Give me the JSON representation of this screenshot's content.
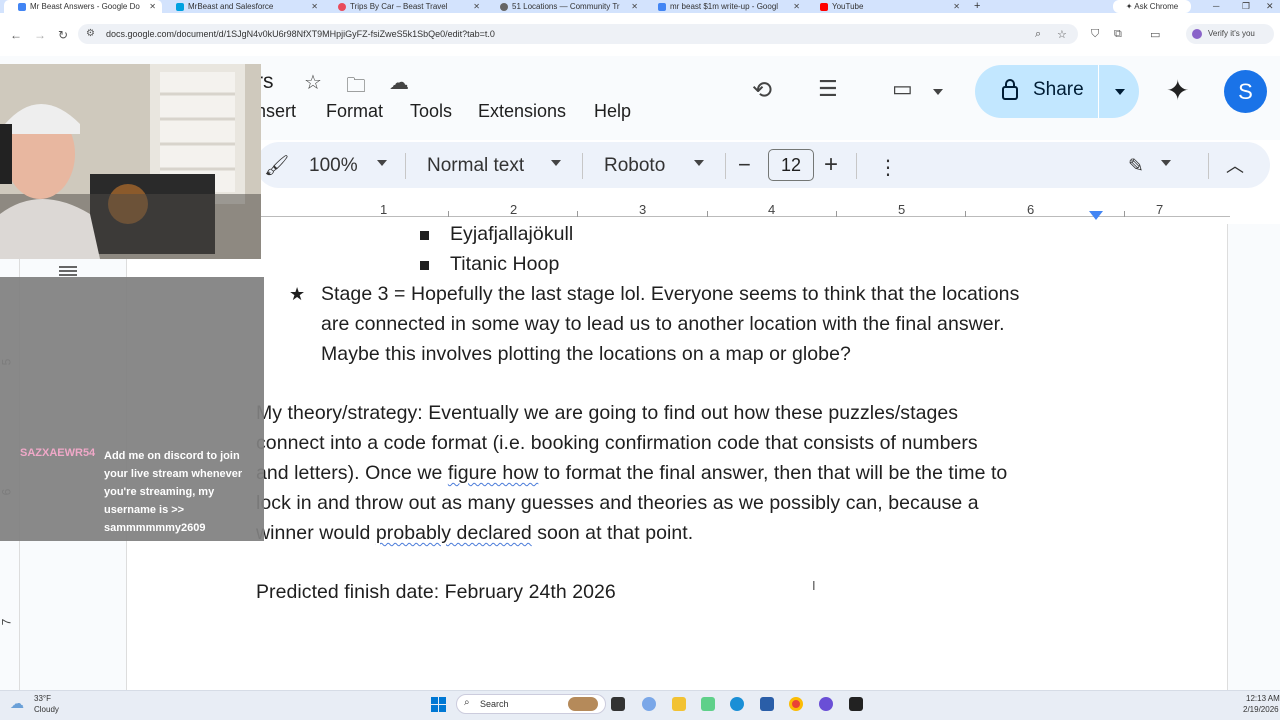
{
  "browser": {
    "tabs": [
      {
        "title": "Mr Beast Answers - Google Do",
        "active": true
      },
      {
        "title": "MrBeast and Salesforce",
        "active": false
      },
      {
        "title": "Trips By Car – Beast Travel",
        "active": false
      },
      {
        "title": "51 Locations — Community Tr",
        "active": false
      },
      {
        "title": "mr beast $1m write-up - Googl",
        "active": false
      },
      {
        "title": "YouTube",
        "active": false
      }
    ],
    "ask_chrome": "Ask Chrome",
    "url": "docs.google.com/document/d/1SJgN4v0kU6r98NfXT9MHpjiGyFZ-fsiZweS5k1SbQe0/edit?tab=t.0",
    "verify_label": "Verify it's you"
  },
  "docs": {
    "title_fragment": "rs",
    "menus": [
      "nsert",
      "Format",
      "Tools",
      "Extensions",
      "Help"
    ],
    "share_label": "Share",
    "avatar_letter": "S",
    "toolbar": {
      "zoom": "100%",
      "style": "Normal text",
      "font": "Roboto",
      "font_size": "12",
      "minus": "−",
      "plus": "+"
    },
    "ruler_numbers": [
      "1",
      "2",
      "3",
      "4",
      "5",
      "6",
      "7"
    ],
    "vruler_numbers": [
      "5",
      "6",
      "7"
    ],
    "content": {
      "sub_bullets": [
        "Eyjafjallajökull",
        "Titanic Hoop"
      ],
      "stage3_lines": [
        "Stage 3 = Hopefully the last stage lol. Everyone seems to think that the locations",
        "are connected in some way to lead us to another location with the final answer.",
        "Maybe this involves plotting the locations on a map or globe?"
      ],
      "theory_lines": {
        "l1": "My theory/strategy: Eventually we are going to find out how these puzzles/stages",
        "l2": "connect into a code format (i.e. booking confirmation code that consists of numbers",
        "l3_a": "and letters). Once we ",
        "l3_b": "figure how",
        "l3_c": " to format the final answer, then that will be the time to",
        "l4": "lock in and throw out as many guesses and theories as we possibly can, because a",
        "l5_a": "winner would ",
        "l5_b": "probably declared",
        "l5_c": " soon at that point."
      },
      "finish": "Predicted finish date: February 24th 2026"
    }
  },
  "overlay": {
    "chat_user": "SAZXAEWR54",
    "chat_message": "Add me on discord to join your live stream whenever you're streaming, my username is >> sammmmmmy2609"
  },
  "taskbar": {
    "temperature": "33°F",
    "weather": "Cloudy",
    "search": "Search",
    "time": "12:13 AM",
    "date": "2/19/2026"
  }
}
